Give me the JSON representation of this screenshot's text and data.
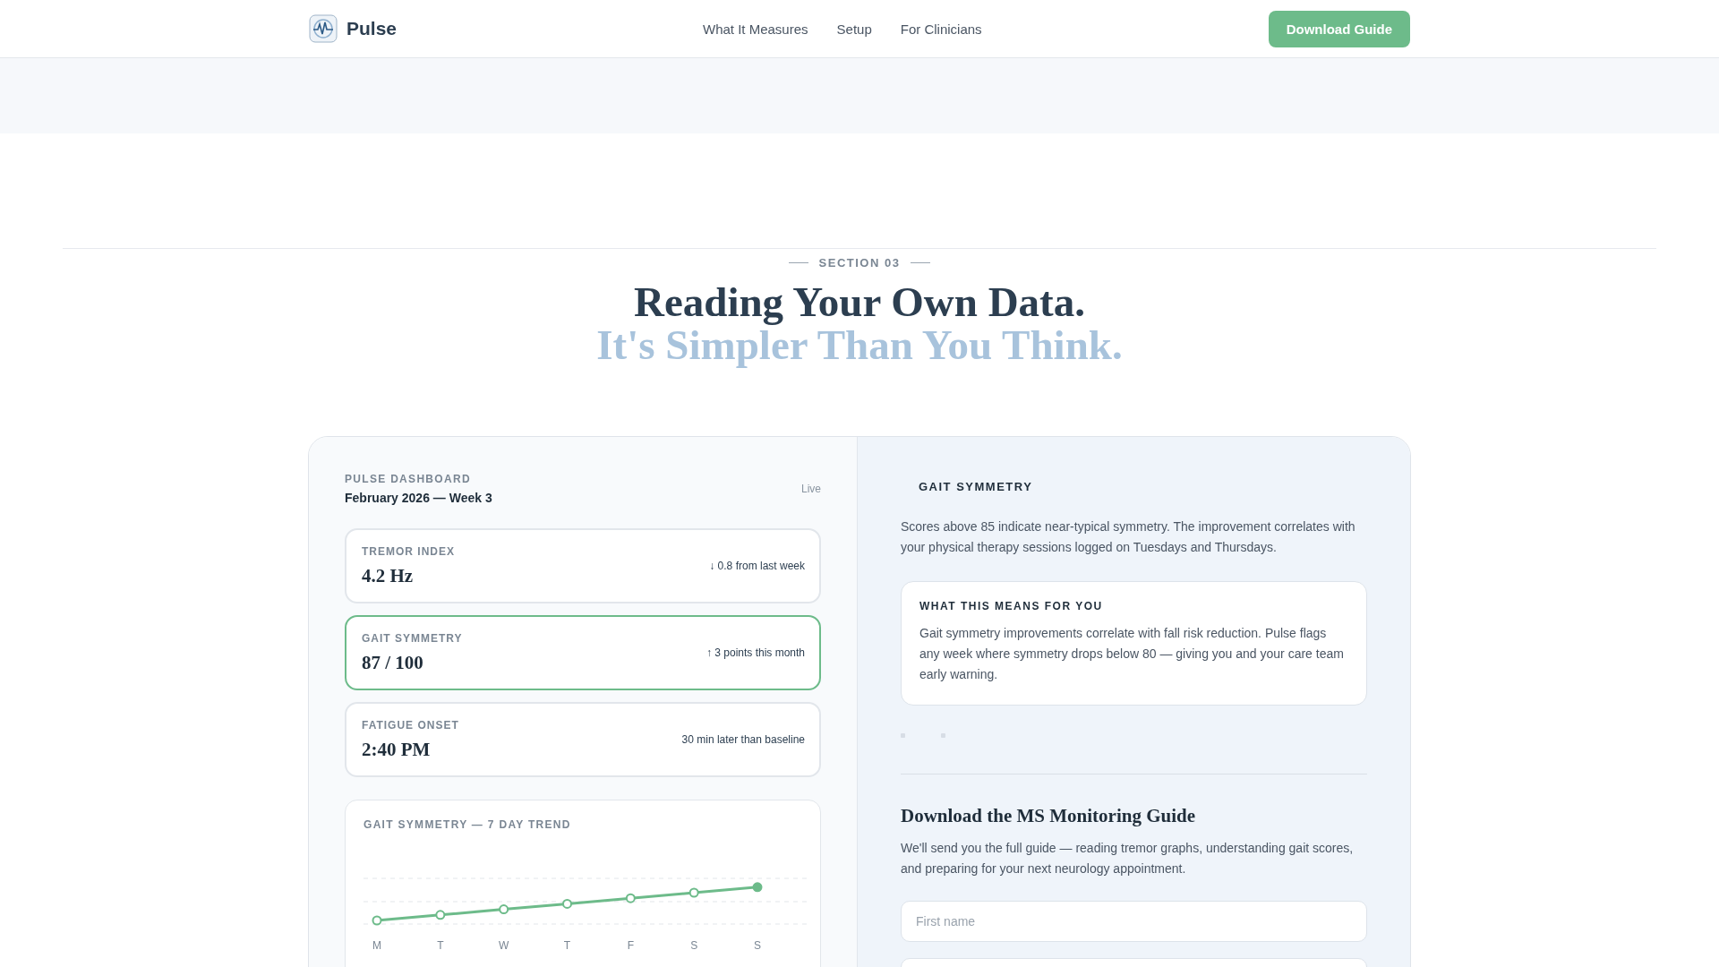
{
  "nav": {
    "brand": "Pulse",
    "links": [
      "What It Measures",
      "Setup",
      "For Clinicians"
    ],
    "cta": "Download Guide"
  },
  "section": {
    "eyebrow": "SECTION 03",
    "title": "Reading Your Own Data.",
    "subtitle": "It's Simpler Than You Think."
  },
  "dashboard": {
    "label": "PULSE DASHBOARD",
    "period": "February 2026 — Week 3",
    "status": "Live",
    "metrics": [
      {
        "label": "TREMOR INDEX",
        "value": "4.2 Hz",
        "change": "↓ 0.8 from last week",
        "highlighted": false
      },
      {
        "label": "GAIT SYMMETRY",
        "value": "87 / 100",
        "change": "↑ 3 points this month",
        "highlighted": true
      },
      {
        "label": "FATIGUE ONSET",
        "value": "2:40 PM",
        "change": "30 min later than baseline",
        "highlighted": false
      }
    ],
    "trend": {
      "title": "GAIT SYMMETRY — 7 DAY TREND",
      "days": [
        "M",
        "T",
        "W",
        "T",
        "F",
        "S",
        "S"
      ]
    }
  },
  "detail": {
    "title": "GAIT SYMMETRY",
    "text": "Scores above 85 indicate near-typical symmetry. The improvement correlates with your physical therapy sessions logged on Tuesdays and Thursdays.",
    "callout": {
      "title": "WHAT THIS MEANS FOR YOU",
      "text": "Gait symmetry improvements correlate with fall risk reduction. Pulse flags any week where symmetry drops below 80 — giving you and your care team early warning."
    }
  },
  "guide": {
    "title": "Download the MS Monitoring Guide",
    "text": "We'll send you the full guide — reading tremor graphs, understanding gait scores, and preparing for your next neurology appointment.",
    "fields": [
      {
        "kind": "text",
        "placeholder": "First name"
      },
      {
        "kind": "text"
      }
    ]
  }
}
